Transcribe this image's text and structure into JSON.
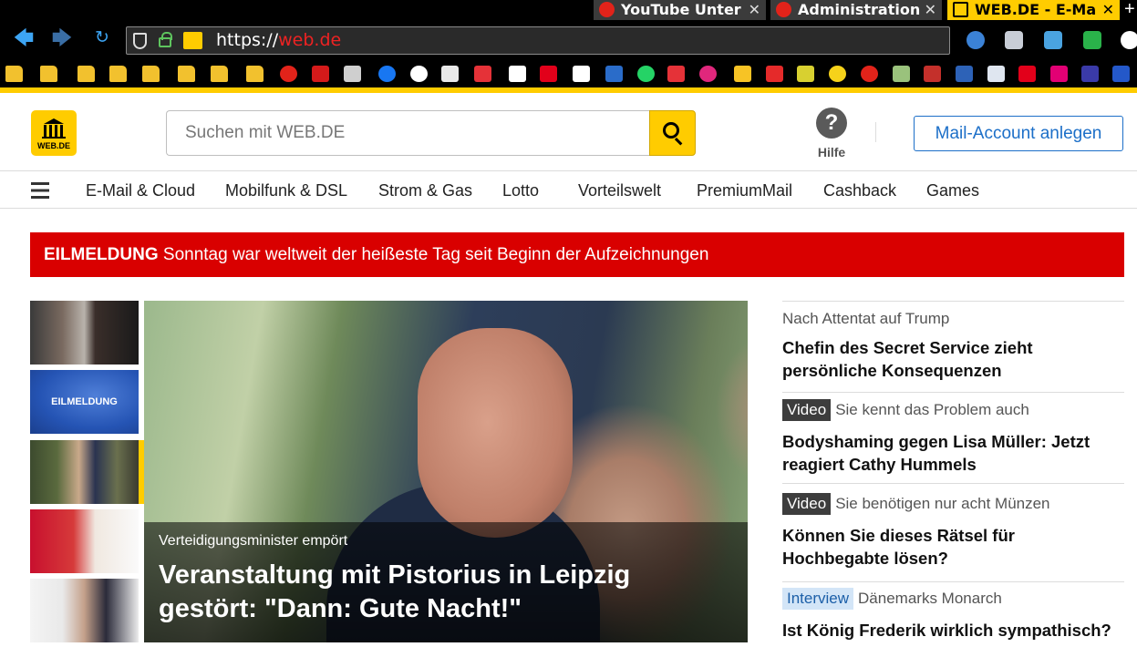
{
  "browser": {
    "tabs": [
      {
        "label": "YouTube Unter",
        "close": "✕"
      },
      {
        "label": "Administration",
        "close": "✕"
      },
      {
        "label": "WEB.DE - E-Ma",
        "close": "✕"
      }
    ],
    "new_tab": "+",
    "url": {
      "scheme": "https://",
      "host": "web.de"
    },
    "icons": {
      "back": "back-arrow-icon",
      "forward": "forward-arrow-icon",
      "reload": "reload-icon",
      "shield": "shield-icon",
      "lock": "lock-icon"
    }
  },
  "site": {
    "logo_text": "WEB.DE",
    "search_placeholder": "Suchen mit WEB.DE",
    "help_label": "Hilfe",
    "help_icon": "?",
    "mail_button": "Mail-Account anlegen",
    "accent": "#ffcc00",
    "link_blue": "#1c6fc8"
  },
  "nav": {
    "items": [
      "E-Mail & Cloud",
      "Mobilfunk & DSL",
      "Strom & Gas",
      "Lotto",
      "Vorteilswelt",
      "PremiumMail",
      "Cashback",
      "Games"
    ]
  },
  "breaking": {
    "label": "EILMELDUNG",
    "text": "Sonntag war weltweit der heißeste Tag seit Beginn der Aufzeichnungen",
    "color": "#d90000"
  },
  "thumbs": {
    "eilmeldung_text": "EILMELDUNG"
  },
  "hero": {
    "kicker": "Verteidigungsminister empört",
    "title": "Veranstaltung mit Pistorius in Leipzig gestört: \"Dann: Gute Nacht!\""
  },
  "articles": [
    {
      "kicker": "Nach Attentat auf Trump",
      "headline": "Chefin des Secret Service zieht persönliche Konsequenzen"
    },
    {
      "badge": "Video",
      "kicker": "Sie kennt das Problem auch",
      "headline": "Bodyshaming gegen Lisa Müller: Jetzt reagiert Cathy Hummels"
    },
    {
      "badge": "Video",
      "kicker": "Sie benötigen nur acht Münzen",
      "headline": "Können Sie dieses Rätsel für Hochbegabte lösen?"
    },
    {
      "badge": "Interview",
      "kicker": "Dänemarks Monarch",
      "headline": "Ist König Frederik wirklich sympathisch?"
    }
  ]
}
